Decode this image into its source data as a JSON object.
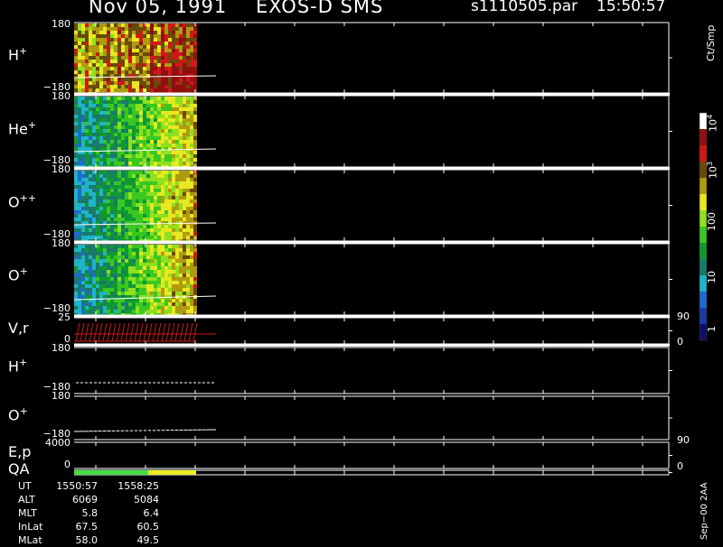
{
  "header": {
    "date": "Nov 05, 1991",
    "instrument": "EXOS-D SMS",
    "file": "s1110505.par",
    "time": "15:50:57"
  },
  "panels": [
    {
      "label_base": "H",
      "label_sup": "+",
      "ymax": "180",
      "ymin": "−180"
    },
    {
      "label_base": "He",
      "label_sup": "+",
      "ymax": "180",
      "ymin": "−180"
    },
    {
      "label_base": "O",
      "label_sup": "++",
      "ymax": "180",
      "ymin": "−180"
    },
    {
      "label_base": "O",
      "label_sup": "+",
      "ymax": "180",
      "ymin": "−180"
    },
    {
      "label_base": "V,r",
      "label_sup": "",
      "ymax": "25",
      "ymin": "0",
      "rmax": "90",
      "rmin": "0"
    },
    {
      "label_base": "H",
      "label_sup": "+",
      "ymax": "180",
      "ymin": "−180"
    },
    {
      "label_base": "O",
      "label_sup": "+",
      "ymax": "180",
      "ymin": "−180"
    },
    {
      "label_base": "E,p",
      "label_sup": "",
      "ymax": "4000",
      "ymin": "0",
      "rmax": "90",
      "rmin": "0"
    },
    {
      "label_base": "QA",
      "label_sup": ""
    }
  ],
  "colorbar": {
    "unit": "Ct/Smp",
    "labels": [
      {
        "base": "10",
        "sup": "4"
      },
      {
        "base": "10",
        "sup": "3"
      },
      {
        "base": "100",
        "sup": ""
      },
      {
        "base": "10",
        "sup": ""
      },
      {
        "base": "1",
        "sup": ""
      }
    ],
    "colors": [
      "#10106a",
      "#1a3aa8",
      "#1e6ad0",
      "#1fb4c8",
      "#1a7a6a",
      "#0f9a30",
      "#3ac820",
      "#8ee020",
      "#e8e820",
      "#b09a10",
      "#6a4a08",
      "#d01818",
      "#901010",
      "#ffffff"
    ]
  },
  "footer": {
    "rows": [
      {
        "label": "UT",
        "v1": "1550:57",
        "v2": "1558:25"
      },
      {
        "label": "ALT",
        "v1": "6069",
        "v2": "5084"
      },
      {
        "label": "MLT",
        "v1": "5.8",
        "v2": "6.4"
      },
      {
        "label": "InLat",
        "v1": "67.5",
        "v2": "60.5"
      },
      {
        "label": "MLat",
        "v1": "58.0",
        "v2": "49.5"
      }
    ],
    "note": "Sep−00 2AA"
  },
  "chart_data": {
    "type": "heatmap",
    "title": "Nov 05, 1991   EXOS-D SMS",
    "x_time_range": [
      "1550:57",
      "1558:25"
    ],
    "colorbar_unit": "Ct/Smp",
    "colorbar_scale": "log",
    "colorbar_range": [
      1,
      10000
    ],
    "panels": [
      "H+",
      "He+",
      "O++",
      "O+",
      "V,r",
      "H+",
      "O+",
      "E,p",
      "QA"
    ],
    "y_ranges": {
      "H+": [
        -180,
        180
      ],
      "He+": [
        -180,
        180
      ],
      "O++": [
        -180,
        180
      ],
      "O+": [
        -180,
        180
      ],
      "V,r": [
        0,
        25
      ],
      "E,p": [
        0,
        4000
      ]
    },
    "right_axis_ranges": {
      "V,r": [
        0,
        90
      ],
      "E,p": [
        0,
        90
      ]
    },
    "qa_colors": [
      "#44dd44",
      "#eeee22"
    ],
    "data_accent": "#d01818"
  }
}
